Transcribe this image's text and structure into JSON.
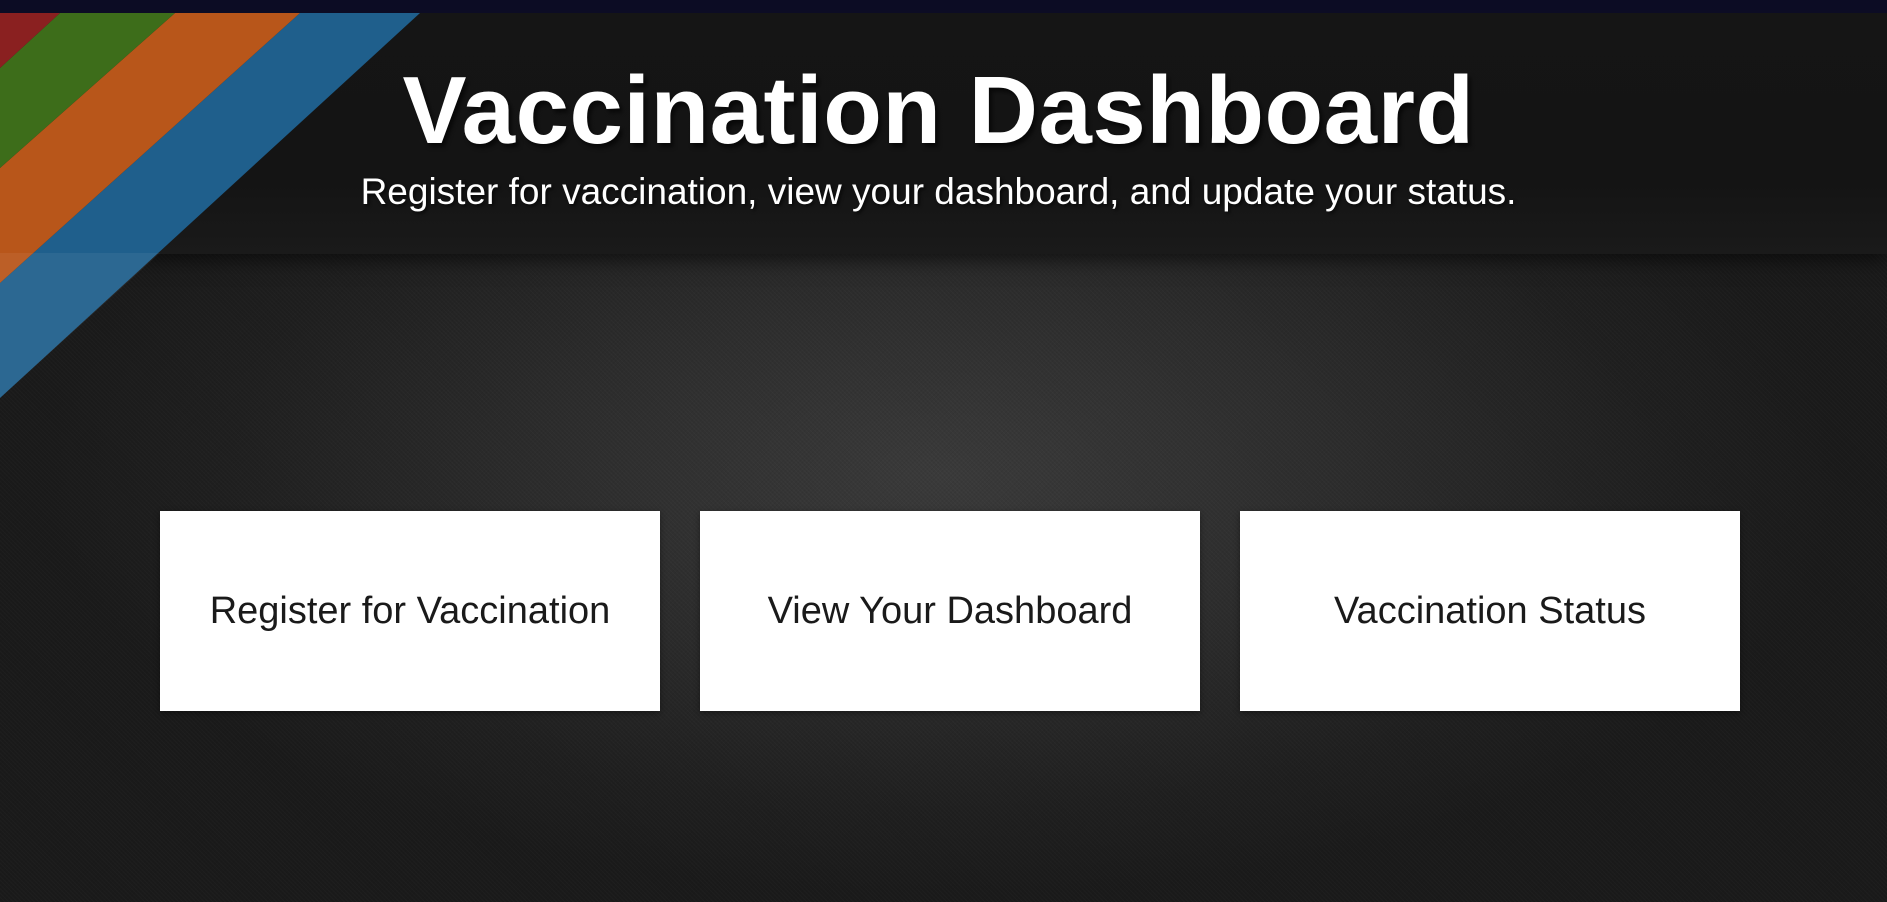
{
  "header": {
    "title": "Vaccination Dashboard",
    "subtitle": "Register for vaccination, view your dashboard, and update your status."
  },
  "actions": [
    {
      "label": "Register for Vaccination"
    },
    {
      "label": "View Your Dashboard"
    },
    {
      "label": "Vaccination Status"
    }
  ],
  "colors": {
    "stripe_red": "#8a2020",
    "stripe_green": "#3d6d1a",
    "stripe_orange": "#b8561a",
    "stripe_blue": "#1f5f8c",
    "background": "#1e1e1e",
    "card": "#ffffff"
  }
}
